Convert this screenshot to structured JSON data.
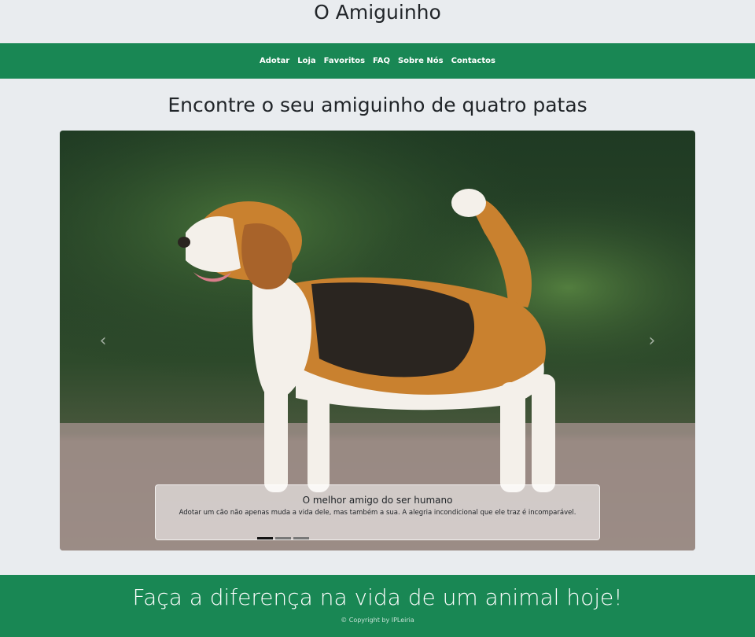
{
  "site": {
    "title": "O Amiguinho"
  },
  "nav": {
    "items": [
      {
        "label": "Adotar"
      },
      {
        "label": "Loja"
      },
      {
        "label": "Favoritos"
      },
      {
        "label": "FAQ"
      },
      {
        "label": "Sobre Nós"
      },
      {
        "label": "Contactos"
      }
    ]
  },
  "main": {
    "heading": "Encontre o seu amiguinho de quatro patas"
  },
  "carousel": {
    "prev_icon": "‹",
    "next_icon": "›",
    "caption": {
      "title": "O melhor amigo do ser humano",
      "text": "Adotar um cão não apenas muda a vida dele, mas também a sua. A alegria incondicional que ele traz é incomparável."
    },
    "indicators": [
      {
        "state": "active"
      },
      {
        "state": "inactive"
      },
      {
        "state": "inactive"
      }
    ]
  },
  "footer": {
    "tagline": "Faça a diferença na vida de um animal hoje!",
    "copyright": "© Copyright by IPLeiria"
  },
  "colors": {
    "brand_green": "#198754",
    "page_background": "#e9ecef"
  }
}
